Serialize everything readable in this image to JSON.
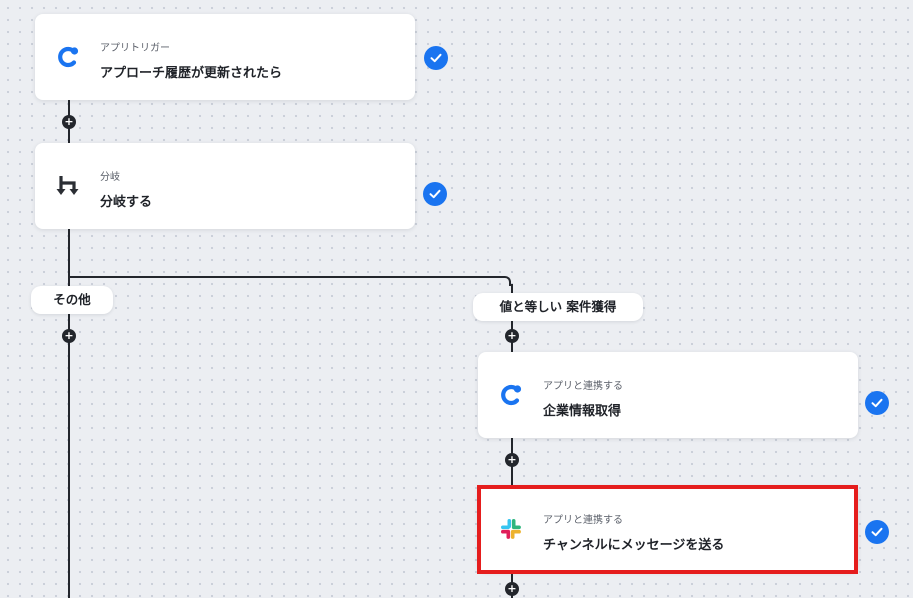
{
  "flow": {
    "steps": [
      {
        "category": "アプリトリガー",
        "title": "アプローチ履歴が更新されたら",
        "icon": "app-trigger-logo-icon",
        "status": "completed"
      },
      {
        "category": "分岐",
        "title": "分岐する",
        "icon": "branch-icon",
        "status": "completed"
      }
    ],
    "branches": {
      "left": {
        "label": "その他"
      },
      "right": {
        "label": "値と等しい 案件獲得",
        "steps": [
          {
            "category": "アプリと連携する",
            "title": "企業情報取得",
            "icon": "app-logo-icon",
            "status": "completed"
          },
          {
            "category": "アプリと連携する",
            "title": "チャンネルにメッセージを送る",
            "icon": "slack-icon",
            "status": "completed",
            "selected": true
          }
        ]
      }
    }
  },
  "colors": {
    "accent": "#1a74f0",
    "selection": "#e51d1d",
    "connector": "#23262c",
    "background": "#eceef2"
  }
}
